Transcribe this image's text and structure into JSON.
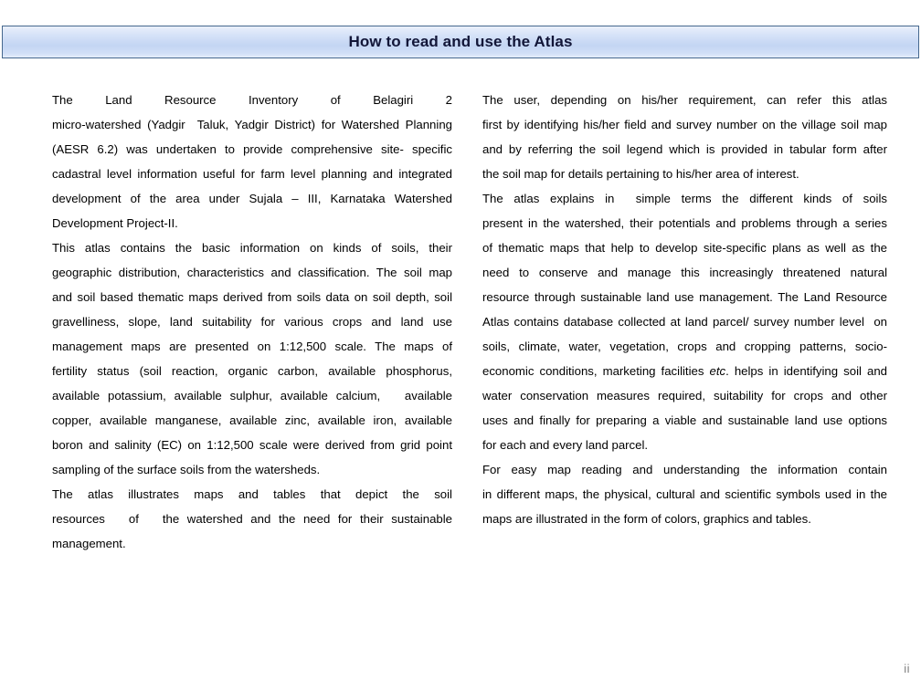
{
  "header": {
    "title": "How to read and use the Atlas"
  },
  "footer": {
    "page_number": "ii"
  },
  "left_column": {
    "paragraphs": [
      {
        "id": "intro",
        "lines": [
          "The   Land   Resource   Inventory   of   Belagiri   2",
          "micro-watershed (Yadgir  Taluk, Yadgir District) for Watershed Planning",
          "(AESR 6.2) was undertaken to provide comprehensive site- specific",
          "cadastral level information useful for farm level planning and integrated",
          "development of the area under Sujala – III, Karnataka Watershed",
          "Development Project-II."
        ]
      },
      {
        "id": "contents",
        "lines": [
          "This atlas contains the basic information on kinds of soils, their",
          "geographic distribution, characteristics and classification. The soil map",
          "and soil based thematic maps derived from soils data on soil depth, soil",
          "gravelliness, slope, land suitability for various crops and land use",
          "management maps are presented on 1:12,500 scale. The maps of",
          "fertility status (soil reaction, organic carbon, available phosphorus,",
          "available potassium, available sulphur, available calcium,   available",
          "copper, available manganese, available zinc, available iron, available",
          "boron and salinity (EC) on 1:12,500 scale were derived from grid point",
          "sampling of the surface soils from the watersheds."
        ]
      },
      {
        "id": "illustrates",
        "lines": [
          "The atlas illustrates maps and tables that depict the soil",
          "resources   of   the watershed and the need for their sustainable",
          "management."
        ]
      }
    ]
  },
  "right_column": {
    "paragraphs": [
      {
        "id": "user-guidance",
        "lines": [
          "The user, depending on his/her requirement, can refer this atlas",
          "first by identifying his/her field and survey number on the village soil map",
          "and by referring the soil legend which is provided in tabular form after",
          "the soil map for details pertaining to his/her area of interest."
        ]
      },
      {
        "id": "explains",
        "lines_before_italic": [
          "The atlas explains in  simple terms the different kinds of soils",
          "present in the watershed, their potentials and problems through a series",
          "of thematic maps that help to develop site-specific plans as well as the",
          "need to conserve and manage this increasingly threatened natural",
          "resource through sustainable land use management. The Land Resource",
          "Atlas contains database collected at land parcel/ survey number level  on",
          "soils, climate, water, vegetation, crops and cropping patterns, socio-"
        ],
        "italic_line_prefix": "economic conditions, marketing facilities ",
        "italic_word": "etc",
        "italic_line_suffix": ". helps in identifying soil and",
        "lines_after_italic": [
          "water conservation measures required, suitability for crops and other",
          "uses and finally for preparing a viable and sustainable land use options",
          "for each and every land parcel."
        ]
      },
      {
        "id": "map-reading",
        "lines": [
          "For easy map reading and understanding the information contain",
          "in different maps, the physical, cultural and scientific symbols used in the",
          "maps are illustrated in the form of colors, graphics and tables."
        ]
      }
    ]
  }
}
